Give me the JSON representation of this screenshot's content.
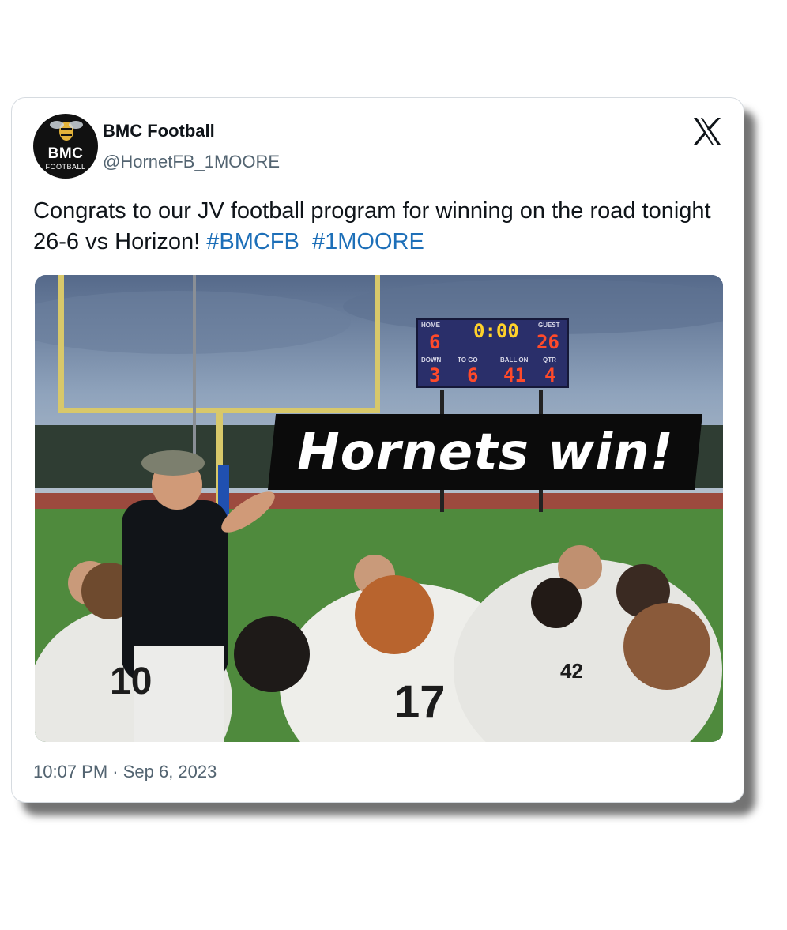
{
  "tweet": {
    "author_name": "BMC Football",
    "author_handle": "@HornetFB_1MOORE",
    "avatar": {
      "abbreviation": "BMC",
      "subtitle": "FOOTBALL",
      "icon": "hornet-mascot-icon"
    },
    "text_main": "Congrats to our JV football program for winning on the road tonight 26-6 vs Horizon!",
    "hashtags": [
      "#BMCFB",
      "#1MOORE"
    ],
    "timestamp": "10:07 PM · Sep 6, 2023",
    "platform_icon": "x-logo-icon"
  },
  "media": {
    "banner_text": "Hornets win!",
    "scoreboard": {
      "home_label": "HOME",
      "guest_label": "GUEST",
      "home_score": "6",
      "guest_score": "26",
      "clock": "0:00",
      "down_label": "DOWN",
      "to_go_label": "TO GO",
      "ball_on_label": "BALL ON",
      "qtr_label": "QTR",
      "down": "3",
      "to_go": "6",
      "ball_on": "41",
      "qtr": "4"
    },
    "jerseys": [
      "10",
      "17",
      "42"
    ]
  },
  "colors": {
    "hashtag": "#1d6fb8",
    "muted": "#536471",
    "banner": "#0b0b0b"
  }
}
